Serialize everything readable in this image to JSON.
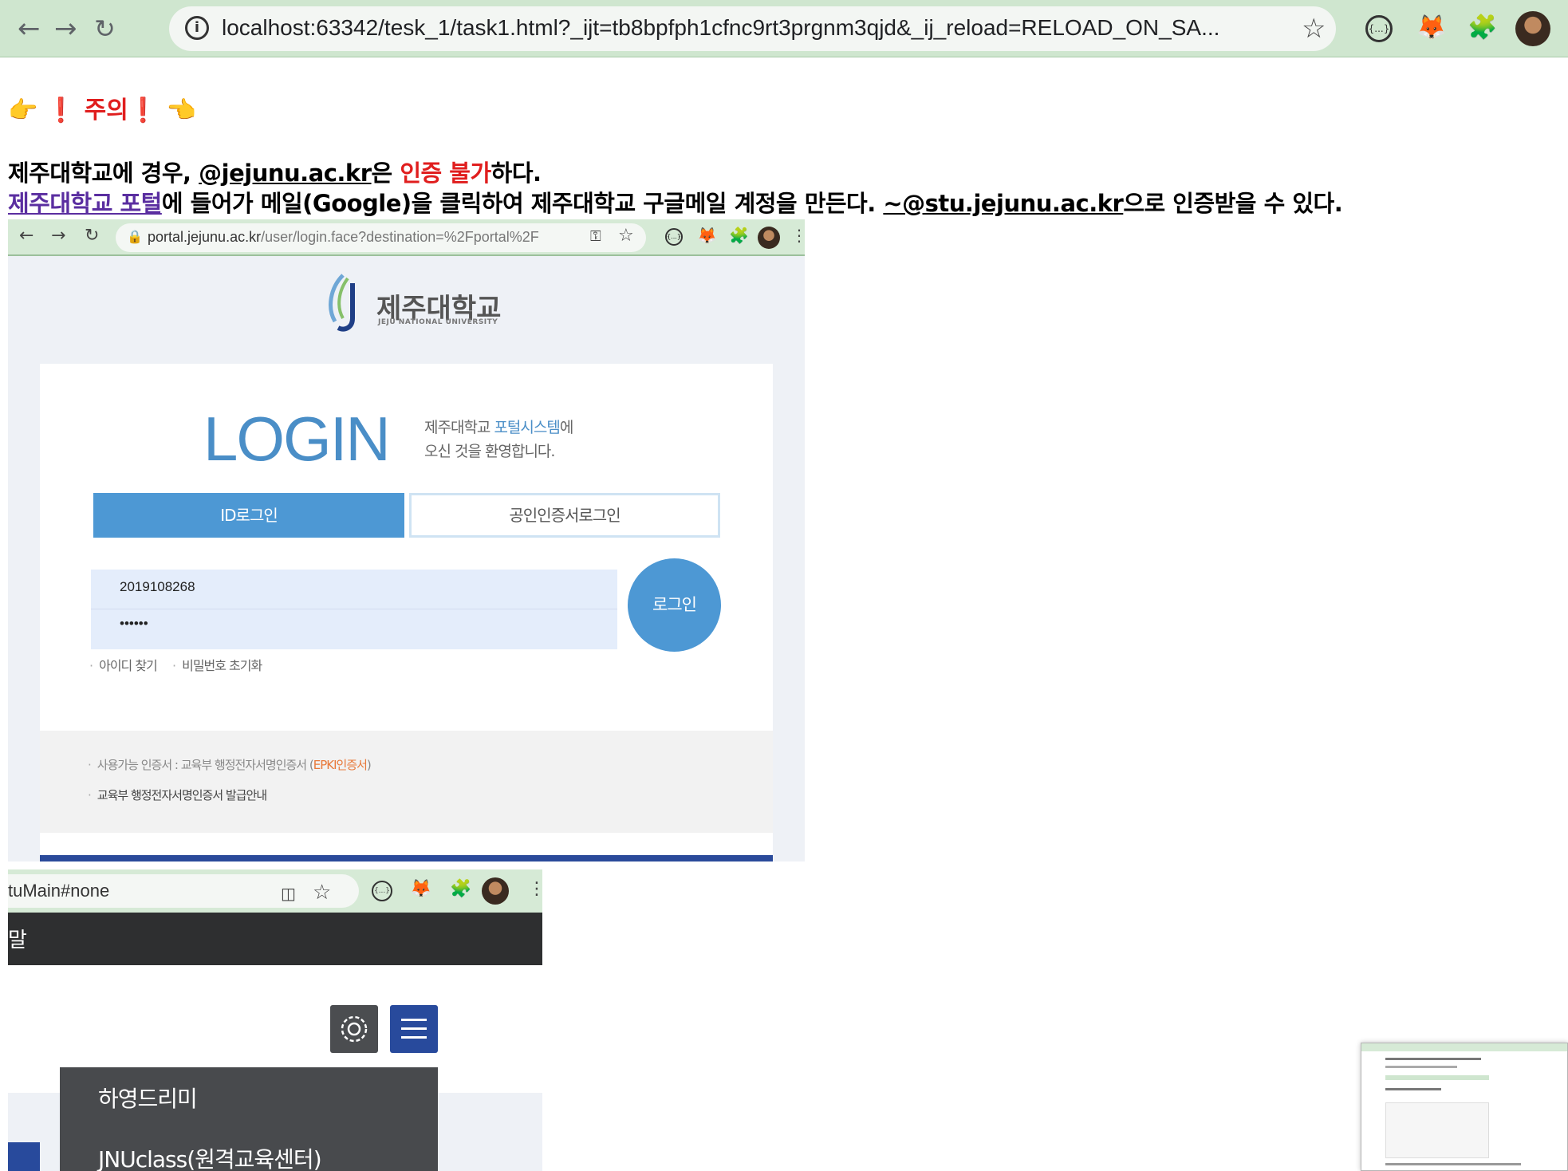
{
  "browser": {
    "url": "localhost:63342/tesk_1/task1.html?_ijt=tb8bpfph1cfnc9rt3prgnm3qjd&_ij_reload=RELOAD_ON_SA...",
    "json_ext_label": "{...}"
  },
  "notice": {
    "warning": "👉 ❗ 주의❗ 👈",
    "line1": {
      "a": "제주대학교에 경우, ",
      "domain": "@jejunu.ac.kr",
      "b": "은 ",
      "red": "인증 불가",
      "c": "하다."
    },
    "line2": {
      "link": "제주대학교 포털",
      "a": "에 들어가 메일(Google)을 클릭하여 제주대학교 구글메일 계정을 만든다. ",
      "domain": "~@stu.jejunu.ac.kr",
      "b": "으로 인증받을 수 있다."
    }
  },
  "portal_screenshot": {
    "url_host": "portal.jejunu.ac.kr",
    "url_path": "/user/login.face?destination=%2Fportal%2F",
    "json_ext_label": "{...}",
    "university_name": "제주대학교",
    "university_name_en": "JEJU NATIONAL UNIVERSITY",
    "login_title": "LOGIN",
    "welcome_prefix": "제주대학교 ",
    "welcome_accent": "포털시스템",
    "welcome_suffix": "에",
    "welcome_line2": "오신 것을 환영합니다.",
    "tab_id": "ID로그인",
    "tab_cert": "공인인증서로그인",
    "username_value": "2019108268",
    "password_value": "••••••",
    "login_button": "로그인",
    "find_id": "아이디 찾기",
    "reset_password": "비밀번호 초기화",
    "info1_prefix": "사용가능 인증서 : 교육부 행정전자서명인증서 (",
    "info1_accent": "EPKI인증서",
    "info1_suffix": ")",
    "info2": "교육부 행정전자서명인증서 발급안내"
  },
  "menu_screenshot": {
    "url_tail": "tuMain#none",
    "json_ext_label": "{...}",
    "dark_bar_text": "말",
    "menu_item1": "하영드리미",
    "menu_item2": "JNUclass(원격교육센터)"
  }
}
